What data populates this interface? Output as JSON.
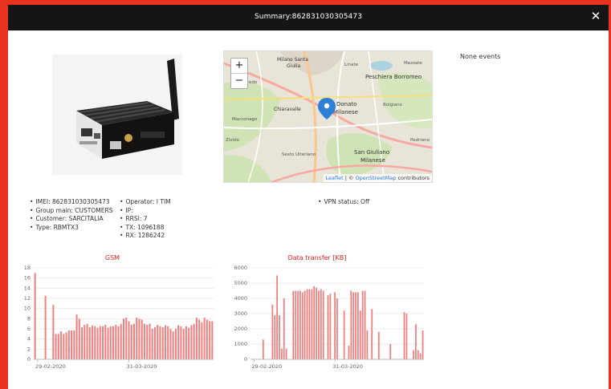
{
  "modal": {
    "title": "Summary:862831030305473",
    "close_glyph": "✕"
  },
  "device": {
    "image_icon": "router-device-icon"
  },
  "map": {
    "zoom_in": "+",
    "zoom_out": "−",
    "places": [
      "Milano Santa Giulia",
      "Peschiera Borromeo",
      "Linate",
      "Mezzate",
      "Donato Milanese",
      "Bolgiano",
      "Chiaravalle",
      "Macconago",
      "Zivido",
      "San Giuliano Milanese",
      "Sesto Ulteriano",
      "Rogoredo",
      "Pedriano"
    ],
    "attribution_leaflet": "Leaflet",
    "attribution_sep": " | © ",
    "attribution_osm": "OpenStreetMap",
    "attribution_tail": " contributors",
    "marker_icon": "map-marker-icon"
  },
  "events": {
    "text": "None events"
  },
  "info": {
    "col1": [
      "IMEI: 862831030305473",
      "Group main: CUSTOMERS",
      "Customer: SARCITALIA",
      "Type: RBMTX3"
    ],
    "col2": [
      "Operator: I TIM",
      "IP:",
      "RRSI: 7",
      "TX: 1096188",
      "RX: 1286242"
    ],
    "col3": [
      "VPN status: Off"
    ]
  },
  "chart_data": [
    {
      "type": "bar",
      "title": "GSM",
      "xlabel": "",
      "ylabel": "",
      "ylim": [
        0,
        18
      ],
      "yticks": [
        0,
        2,
        4,
        6,
        8,
        10,
        12,
        14,
        16,
        18
      ],
      "xticks": [
        "29-02-2020",
        "31-03-2020"
      ],
      "xtick_index": [
        1,
        36
      ],
      "color": "#f08080",
      "values": [
        17,
        0,
        0,
        0,
        12.5,
        0,
        0,
        10.7,
        5,
        5,
        5.5,
        5,
        5.3,
        5.7,
        5.7,
        5.7,
        8.8,
        8,
        6.3,
        6.8,
        7,
        6.3,
        6.7,
        6.5,
        6.2,
        6.5,
        6.5,
        6.8,
        6.2,
        6.5,
        6.5,
        6.8,
        6.5,
        7,
        8,
        8.2,
        7.5,
        6.8,
        7,
        8.2,
        8,
        7.8,
        7,
        6.8,
        7,
        6,
        6.3,
        6.8,
        6.5,
        6.3,
        6.7,
        6.5,
        6,
        5.5,
        6,
        6.7,
        6.5,
        6,
        6.5,
        6.2,
        6.7,
        7,
        8.2,
        7.8,
        7.3,
        8.2,
        7.8,
        7.5,
        7.5
      ]
    },
    {
      "type": "bar",
      "title": "Data transfer [KB]",
      "xlabel": "",
      "ylabel": "",
      "ylim": [
        0,
        6000
      ],
      "yticks": [
        0,
        1000,
        2000,
        3000,
        4000,
        5000,
        6000
      ],
      "xticks": [
        "29-02-2020",
        "31-03-2020"
      ],
      "xtick_index": [
        1,
        36
      ],
      "color": "#f08080",
      "values": [
        0,
        0,
        0,
        0,
        0,
        1300,
        0,
        0,
        0,
        3600,
        2900,
        5500,
        2900,
        700,
        4000,
        700,
        0,
        0,
        4500,
        4500,
        4500,
        4500,
        4400,
        4500,
        4600,
        4600,
        4600,
        4800,
        4700,
        4500,
        4600,
        4500,
        0,
        4200,
        4300,
        0,
        4400,
        4000,
        0,
        0,
        3200,
        0,
        900,
        4500,
        4400,
        4400,
        4400,
        3200,
        4500,
        4500,
        1900,
        0,
        3300,
        0,
        0,
        1800,
        0,
        0,
        0,
        0,
        1000,
        0,
        0,
        0,
        0,
        0,
        3100,
        3000,
        0,
        0,
        600,
        2300,
        600,
        400,
        1900
      ]
    }
  ]
}
